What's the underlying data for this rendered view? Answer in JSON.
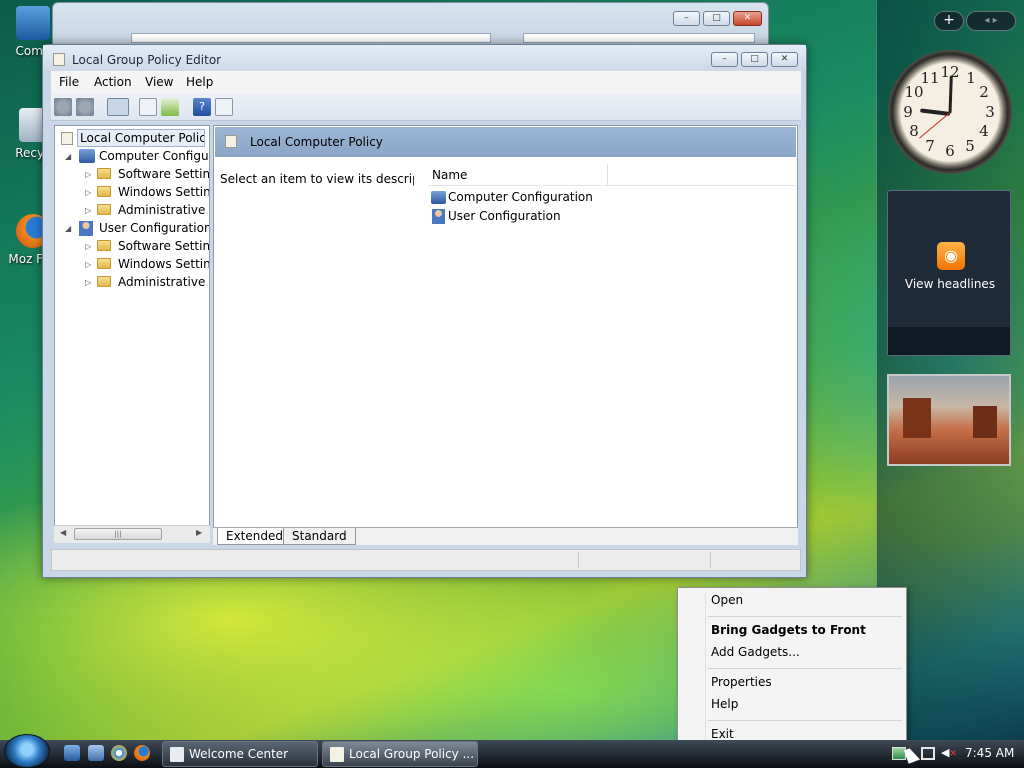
{
  "desktop_icons": [
    {
      "label": "Comp"
    },
    {
      "label": "Recyc"
    },
    {
      "label": "Moz Fire"
    }
  ],
  "sidebar": {
    "add_label": "+",
    "nav_label": "◂ ▸"
  },
  "clock": {
    "numbers": [
      "12",
      "1",
      "2",
      "3",
      "4",
      "5",
      "6",
      "7",
      "8",
      "9",
      "10",
      "11"
    ],
    "time": "7:45"
  },
  "feed_gadget": {
    "caption": "View headlines"
  },
  "bg_window": {
    "title": "Welcome Center"
  },
  "window": {
    "title": "Local Group Policy Editor",
    "menu": [
      "File",
      "Action",
      "View",
      "Help"
    ],
    "tree": [
      {
        "label": "Local Computer Policy"
      },
      {
        "label": "Computer Configuration"
      },
      {
        "label": "Software Settings"
      },
      {
        "label": "Windows Settings"
      },
      {
        "label": "Administrative Templates"
      },
      {
        "label": "User Configuration"
      },
      {
        "label": "Software Settings"
      },
      {
        "label": "Windows Settings"
      },
      {
        "label": "Administrative Templates"
      }
    ],
    "pane_title": "Local Computer Policy",
    "description": "Select an item to view its description.",
    "column": "Name",
    "items": [
      "Computer Configuration",
      "User Configuration"
    ],
    "tabs": [
      "Extended",
      "Standard"
    ]
  },
  "context_menu": [
    "Open",
    "Bring Gadgets to Front",
    "Add Gadgets...",
    "Properties",
    "Help",
    "Exit"
  ],
  "taskbar": {
    "tasks": [
      "Welcome Center",
      "Local Group Policy ..."
    ],
    "time": "7:45 AM"
  }
}
